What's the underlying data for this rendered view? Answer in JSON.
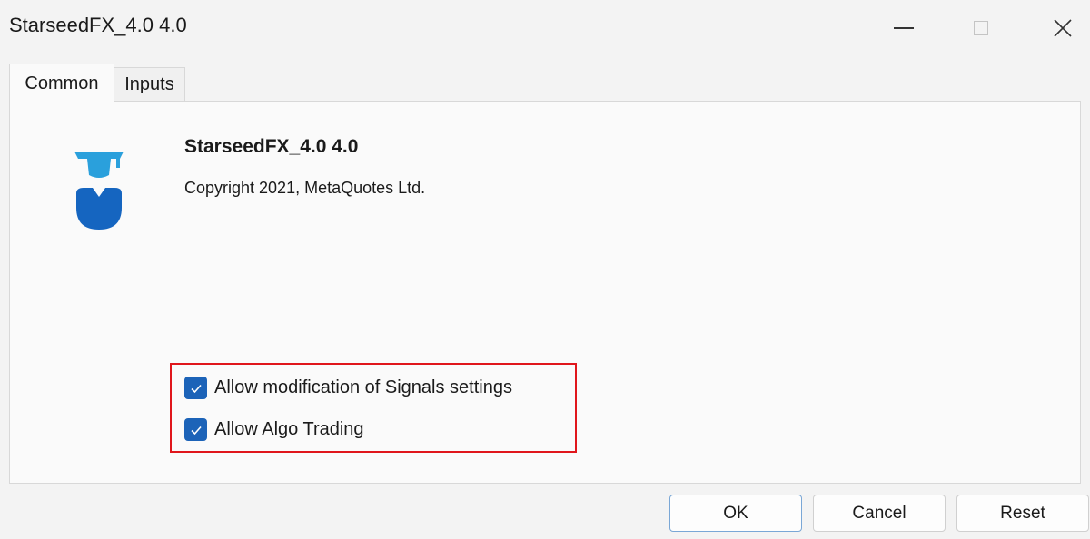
{
  "window": {
    "title": "StarseedFX_4.0 4.0",
    "controls": [
      "minimize-icon",
      "maximize-icon",
      "close-icon"
    ]
  },
  "tabs": [
    {
      "label": "Common",
      "active": true
    },
    {
      "label": "Inputs",
      "active": false
    }
  ],
  "expert": {
    "name": "StarseedFX_4.0 4.0",
    "copyright": "Copyright 2021, MetaQuotes Ltd.",
    "icon": "graduate-icon"
  },
  "options": [
    {
      "label": "Allow modification of Signals settings",
      "checked": true
    },
    {
      "label": "Allow Algo Trading",
      "checked": true
    }
  ],
  "buttons": {
    "ok": "OK",
    "cancel": "Cancel",
    "reset": "Reset"
  },
  "colors": {
    "checkbox": "#1c63b8",
    "highlight": "#e0161c",
    "icon_blue": "#1565c0",
    "icon_light_blue": "#2aa0dc"
  }
}
